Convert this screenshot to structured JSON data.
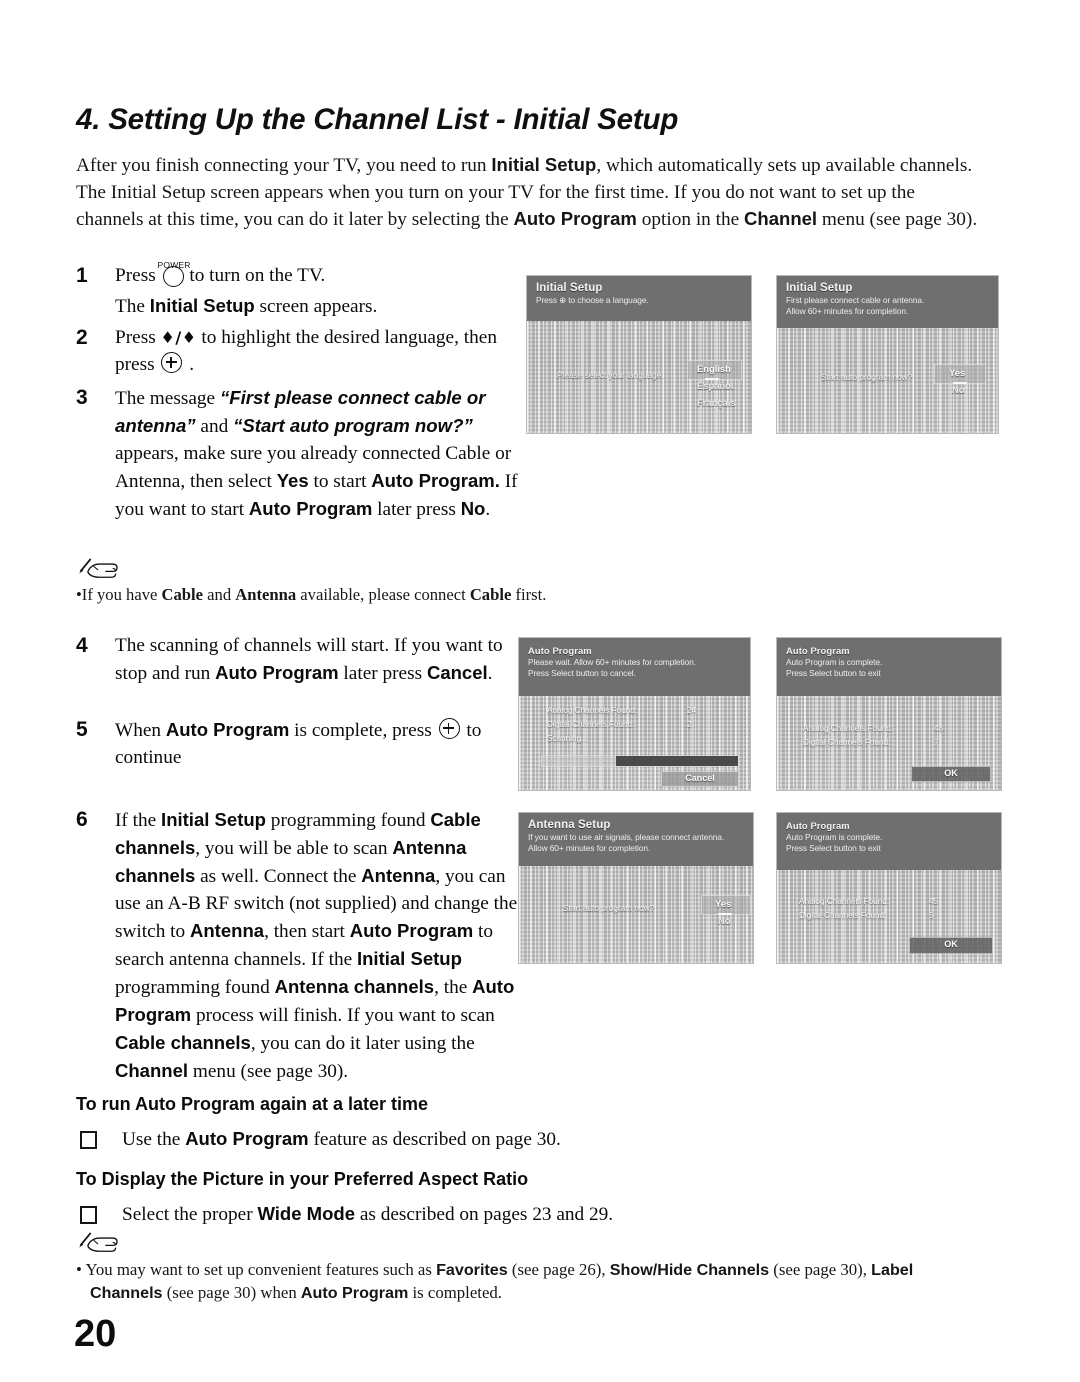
{
  "page": {
    "number": "20",
    "chapter_title": "4. Setting Up the Channel List - Initial Setup"
  },
  "intro": {
    "p1_a": "After you finish connecting your TV, you need to run ",
    "p1_b": "Initial Setup",
    "p1_c": ", which automatically sets up available channels. The Initial Setup screen appears when you turn on your TV for the first time. If you do not want to set up the channels at this time, you can do it later by selecting the ",
    "p1_d": "Auto Program",
    "p1_e": " option in the ",
    "p1_f": "Channel",
    "p1_g": " menu (see page 30)."
  },
  "steps": [
    {
      "num": "1",
      "power_label": "POWER",
      "line1_a": "Press ",
      "line1_b": " to turn on the TV.",
      "line2_a": "The ",
      "line2_b": "Initial Setup",
      "line2_c": " screen appears."
    },
    {
      "num": "2",
      "line1_a": "Press ",
      "arrows": "♦/♦",
      "line1_b": " to highlight the desired language, then press ",
      "line1_c": " ."
    },
    {
      "num": "3",
      "t1": "The message ",
      "q1": "“First please connect cable or antenna”",
      "t2": " and ",
      "q2": "“Start auto program now?”",
      "t3": " appears, make sure you already connected Cable or Antenna, then select ",
      "b1": "Yes",
      "t4": " to start ",
      "b2": "Auto Program.",
      "t5": " If you want to start ",
      "b3": "Auto Program",
      "t6": " later press ",
      "b4": "No",
      "t7": "."
    },
    {
      "num": "4",
      "t1": "The scanning of channels will start. If you want to stop and run ",
      "b1": "Auto Program",
      "t2": " later press ",
      "b2": "Cancel",
      "t3": "."
    },
    {
      "num": "5",
      "t1": "When ",
      "b1": "Auto Program",
      "t2": " is complete, press ",
      "t3": " to continue"
    },
    {
      "num": "6",
      "t1": "If the ",
      "b1": "Initial Setup",
      "t2": " programming found ",
      "b2": "Cable channels",
      "t3": ", you will be able to scan ",
      "b3": "Antenna channels",
      "t4": " as well. Connect the ",
      "b4": "Antenna",
      "t5": ", you can use an A-B RF switch (not supplied) and change the switch to ",
      "b5": "Antenna",
      "t6": ", then start ",
      "b6": "Auto Program",
      "t7": " to search antenna channels. If the ",
      "b7": "Initial Setup",
      "t8": " programming found ",
      "b8": "Antenna channels",
      "t9": ", the ",
      "b9": "Auto Program",
      "t10": " process will finish. If you want to scan ",
      "b10": "Cable channels",
      "t11": ", you can do it later using the ",
      "b11": "Channel",
      "t12": " menu (see page 30)."
    }
  ],
  "note_step3": {
    "icon": "hand-with-pen-icon",
    "t1": "•If you have ",
    "b1": "Cable",
    "t2": " and ",
    "b2": "Antenna",
    "t3": " available, please connect ",
    "b3": "Cable",
    "t4": " first."
  },
  "bottom_sections": [
    {
      "heading": "To run Auto Program again at a later time",
      "item_t1": "Use the ",
      "item_b1": "Auto Program",
      "item_t2": " feature as described on page 30."
    },
    {
      "heading": "To Display the Picture in your Preferred Aspect Ratio",
      "item_t1": "Select the proper ",
      "item_b1": "Wide Mode",
      "item_t2": " as described on pages 23 and 29."
    }
  ],
  "footnote": {
    "icon": "hand-with-pen-icon",
    "t1": "• You may want to set up convenient features such as ",
    "b1": "Favorites",
    "t2": " (see page 26), ",
    "b2": "Show/Hide Channels",
    "t3": " (see page 30), ",
    "b3": "Label Channels",
    "t4": " (see page 30) when ",
    "b4": "Auto Program",
    "t5": " is completed."
  },
  "screenshots": {
    "s1": {
      "title": "Initial Setup",
      "sub1": "Press ⊕ to choose a language.",
      "message": "Please select your language.",
      "options": [
        "English",
        "Español",
        "Français"
      ],
      "selected_option": "English"
    },
    "s2": {
      "title": "Initial Setup",
      "sub1": "First please connect cable or antenna.",
      "sub2": "Allow 60+ minutes for completion.",
      "message": "Start auto program now?",
      "options": [
        "Yes",
        "No"
      ],
      "selected_option": "Yes"
    },
    "s3": {
      "title": "Auto Program",
      "sub1": "Please wait. Allow 60+ minutes for completion.",
      "sub2": "Press Select button to cancel.",
      "rows": [
        {
          "label": "Analog Channels Found:",
          "value": "24"
        },
        {
          "label": "Digital Channels Found:",
          "value": "2"
        }
      ],
      "status": "Scanning...",
      "progress_percent": 62,
      "button": "Cancel"
    },
    "s4": {
      "title": "Auto Program",
      "sub1": "Auto Program is complete.",
      "sub2": "Press Select button to exit",
      "rows": [
        {
          "label": "Analog Channels Found:",
          "value": "48"
        },
        {
          "label": "Digital Channels Found:",
          "value": "7"
        }
      ],
      "button": "OK"
    },
    "s5": {
      "title": "Antenna Setup",
      "sub1": "If you want to use air signals, please connect antenna.",
      "sub2": "Allow 60+ minutes for completion.",
      "message": "Start auto program now?",
      "options": [
        "Yes",
        "No"
      ],
      "selected_option": "Yes"
    },
    "s6": {
      "title": "Auto Program",
      "sub1": "Auto Program is complete.",
      "sub2": "Press Select button to exit",
      "rows": [
        {
          "label": "Analog Channels Found:",
          "value": "45"
        },
        {
          "label": "Digital Channels Found:",
          "value": "5"
        }
      ],
      "button": "OK"
    }
  }
}
